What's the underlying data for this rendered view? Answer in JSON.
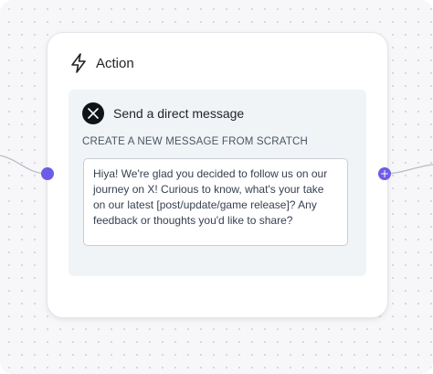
{
  "action_card": {
    "title": "Action",
    "icon": "bolt-icon"
  },
  "integration": {
    "icon": "x-logo-icon",
    "label": "Send a direct message"
  },
  "message": {
    "section_label": "CREATE A NEW MESSAGE FROM SCRATCH",
    "text": "Hiya! We're glad you decided to follow us on our journey on X! Curious to know, what's your take on our latest [post/update/game release]? Any feedback or thoughts you'd like to share?"
  },
  "connectors": {
    "input_handle_icon": "dot-icon",
    "output_handle_icon": "plus-icon",
    "handle_color": "#6c5ce7"
  },
  "colors": {
    "canvas_bg": "#f7f7f9",
    "card_bg": "#ffffff",
    "panel_bg": "#f1f4f7"
  }
}
